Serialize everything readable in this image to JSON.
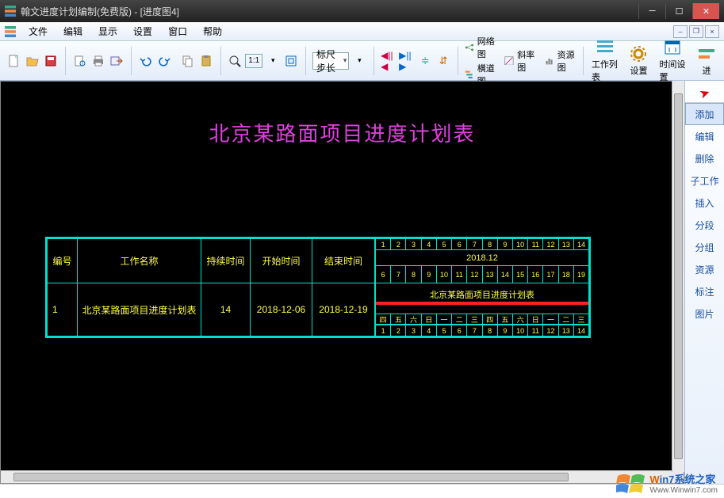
{
  "window": {
    "title": "翰文进度计划编制(免费版) - [进度图4]"
  },
  "menu": [
    "文件",
    "编辑",
    "显示",
    "设置",
    "窗口",
    "帮助"
  ],
  "toolbar": {
    "ruler_select": "标尺步长",
    "net_diagram": "网络图",
    "gantt_diagram": "横道图",
    "slope_diagram": "斜率图",
    "resource_diagram": "资源图",
    "work_list": "工作列表",
    "settings": "设置",
    "time_settings": "时间设置",
    "schedule": "进"
  },
  "side": {
    "items": [
      "添加",
      "编辑",
      "删除",
      "子工作",
      "插入",
      "分段",
      "分组",
      "资源",
      "标注",
      "图片"
    ],
    "active_index": 0
  },
  "chart_data": {
    "type": "table",
    "title": "北京某路面项目进度计划表",
    "columns": [
      "编号",
      "工作名称",
      "持续时间",
      "开始时间",
      "结束时间"
    ],
    "rows": [
      {
        "num": "1",
        "name": "北京某路面项目进度计划表",
        "duration": "14",
        "start": "2018-12-06",
        "end": "2018-12-19"
      }
    ],
    "gantt": {
      "month_label": "2018.12",
      "top_ticks": [
        "1",
        "2",
        "3",
        "4",
        "5",
        "6",
        "7",
        "8",
        "9",
        "10",
        "11",
        "12",
        "13",
        "14"
      ],
      "day_numbers": [
        "6",
        "7",
        "8",
        "9",
        "10",
        "11",
        "12",
        "13",
        "14",
        "15",
        "16",
        "17",
        "18",
        "19"
      ],
      "weekdays": [
        "四",
        "五",
        "六",
        "日",
        "一",
        "二",
        "三",
        "四",
        "五",
        "六",
        "日",
        "一",
        "二",
        "三"
      ],
      "bar_label": "北京某路面项目进度计划表",
      "bottom_ticks": [
        "1",
        "2",
        "3",
        "4",
        "5",
        "6",
        "7",
        "8",
        "9",
        "10",
        "11",
        "12",
        "13",
        "14"
      ]
    }
  },
  "watermark": {
    "brand_prefix": "W",
    "brand_mid": "in7",
    "brand_suffix": "系统之家",
    "url": "Www.Winwin7.com"
  }
}
